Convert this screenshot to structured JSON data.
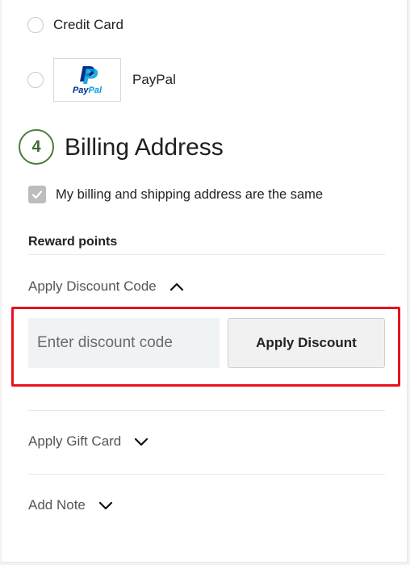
{
  "payment_methods": {
    "credit_card_label": "Credit Card",
    "paypal_label": "PayPal",
    "paypal_logo_text_pay": "Pay",
    "paypal_logo_text_pal": "Pal",
    "paypal_logo_letter": "P"
  },
  "billing": {
    "step_number": "4",
    "title": "Billing Address",
    "same_address_label": "My billing and shipping address are the same",
    "same_address_checked": true
  },
  "reward_points_label": "Reward points",
  "discount": {
    "toggle_label": "Apply Discount Code",
    "input_placeholder": "Enter discount code",
    "input_value": "",
    "apply_button_label": "Apply Discount",
    "expanded": true
  },
  "gift_card": {
    "toggle_label": "Apply Gift Card",
    "expanded": false
  },
  "note": {
    "toggle_label": "Add Note",
    "expanded": false
  },
  "colors": {
    "accent_green": "#4a7c3a",
    "highlight_red": "#e8121c",
    "paypal_dark_blue": "#003087",
    "paypal_light_blue": "#009cde"
  }
}
